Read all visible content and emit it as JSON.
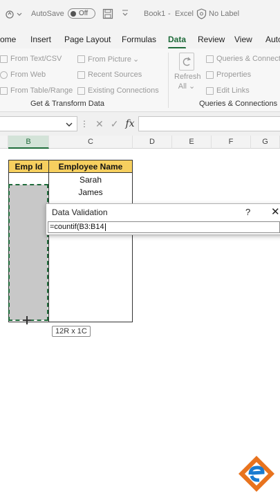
{
  "titlebar": {
    "autosave_label": "AutoSave",
    "autosave_state": "Off",
    "doc_title": "Book1",
    "separator": "-",
    "app_name": "Excel",
    "label_status": "No Label"
  },
  "tabs": [
    {
      "label": "ome"
    },
    {
      "label": "Insert"
    },
    {
      "label": "Page Layout"
    },
    {
      "label": "Formulas"
    },
    {
      "label": "Data",
      "active": true
    },
    {
      "label": "Review"
    },
    {
      "label": "View"
    },
    {
      "label": "Autc"
    }
  ],
  "ribbon": {
    "get_transform": {
      "items": [
        "From Text/CSV",
        "From Web",
        "From Table/Range",
        "From Picture",
        "Recent Sources",
        "Existing Connections"
      ],
      "dropdown_caret": "⌄",
      "group_label": "Get & Transform Data"
    },
    "queries": {
      "refresh_label": "Refresh",
      "all_label": "All",
      "items": [
        "Queries & Connect",
        "Properties",
        "Edit Links"
      ],
      "group_label": "Queries & Connections"
    }
  },
  "formula_bar": {
    "fx_symbol": "fx",
    "cancel_symbol": "✕",
    "enter_symbol": "✓"
  },
  "columns": [
    "B",
    "C",
    "D",
    "E",
    "F",
    "G"
  ],
  "sheet": {
    "header_emp_id": "Emp Id",
    "header_employee_name": "Employee Name",
    "names": [
      "Sarah",
      "James"
    ]
  },
  "selection_tooltip": "12R x 1C",
  "dialog": {
    "title": "Data Validation",
    "help": "?",
    "close": "✕",
    "formula": "=countif(B3:B14"
  },
  "colors": {
    "accent_green": "#1e6b3a",
    "header_fill": "#f6cf5f",
    "selection_fill": "#c8c8c8",
    "logo_orange": "#e8731e",
    "logo_blue": "#1a7bd0"
  }
}
